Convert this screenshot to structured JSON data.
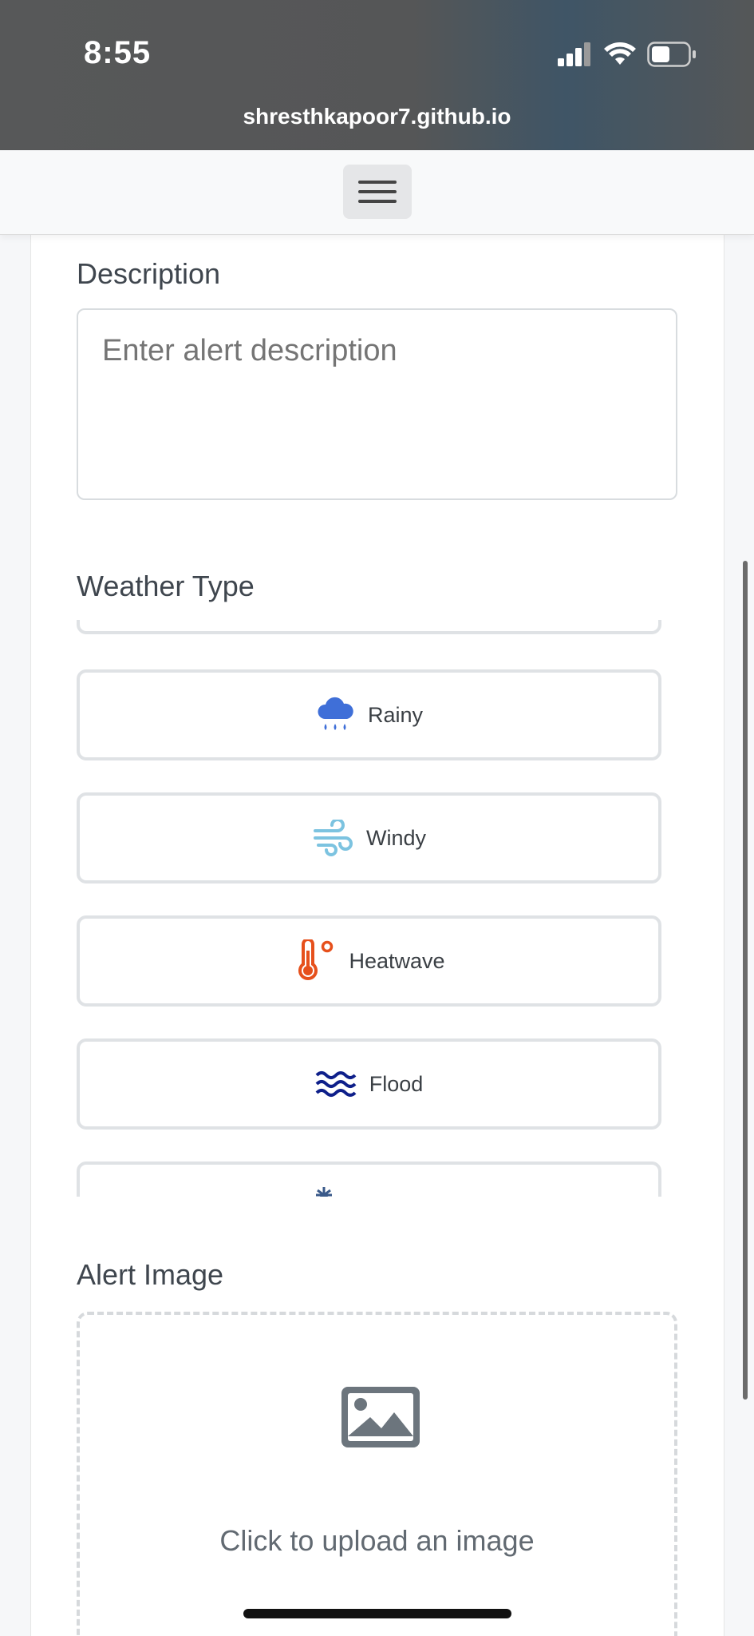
{
  "status_bar": {
    "time": "8:55",
    "url": "shresthkapoor7.github.io"
  },
  "form": {
    "description_label": "Description",
    "description_placeholder": "Enter alert description",
    "weather_label": "Weather Type",
    "weather_options": [
      {
        "label": "Rainy",
        "icon": "rain-cloud-icon",
        "color": "#3f6fd8"
      },
      {
        "label": "Windy",
        "icon": "wind-icon",
        "color": "#7cc3e0"
      },
      {
        "label": "Heatwave",
        "icon": "thermometer-icon",
        "color": "#e6501c"
      },
      {
        "label": "Flood",
        "icon": "water-waves-icon",
        "color": "#0e1f8a"
      }
    ],
    "image_label": "Alert Image",
    "upload_text": "Click to upload an image"
  },
  "colors": {
    "label_text": "#3f464e",
    "border": "#dfe2e5",
    "placeholder": "#a4a9ae"
  }
}
